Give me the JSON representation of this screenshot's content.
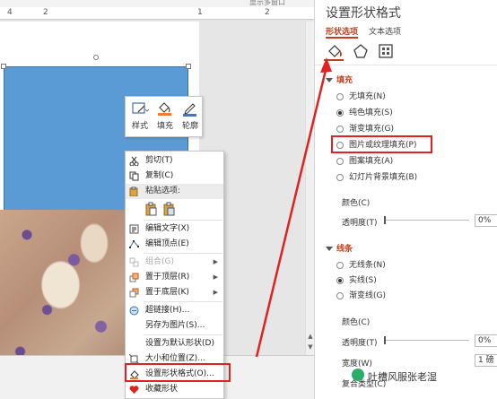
{
  "app": {
    "topstrip_text": "显示多窗口",
    "ruler": [
      "4",
      "2",
      "1",
      "2"
    ]
  },
  "mini_toolbar": {
    "style_label": "样式",
    "fill_label": "填充",
    "outline_label": "轮廓"
  },
  "context_menu": {
    "items": [
      {
        "label": "剪切(T)",
        "icon": "scissors-icon",
        "disabled": false
      },
      {
        "label": "复制(C)",
        "icon": "copy-icon",
        "disabled": false
      },
      {
        "label": "粘贴选项:",
        "icon": "paste-icon",
        "header": true
      },
      {
        "label": "编辑文字(X)",
        "icon": "edit-text-icon",
        "disabled": false
      },
      {
        "label": "编辑顶点(E)",
        "icon": "edit-points-icon",
        "disabled": false
      },
      {
        "label": "组合(G)",
        "icon": "group-icon",
        "disabled": true,
        "submenu": true
      },
      {
        "label": "置于顶层(R)",
        "icon": "bring-front-icon",
        "disabled": false,
        "submenu": true
      },
      {
        "label": "置于底层(K)",
        "icon": "send-back-icon",
        "disabled": false,
        "submenu": true
      },
      {
        "label": "超链接(H)...",
        "icon": "hyperlink-icon",
        "disabled": false
      },
      {
        "label": "另存为图片(S)...",
        "icon": "",
        "disabled": false
      },
      {
        "label": "设置为默认形状(D)",
        "icon": "",
        "disabled": false
      },
      {
        "label": "大小和位置(Z)...",
        "icon": "size-position-icon",
        "disabled": false
      },
      {
        "label": "设置形状格式(O)...",
        "icon": "format-shape-icon",
        "disabled": false,
        "highlighted": true
      },
      {
        "label": "收藏形状",
        "icon": "heart-icon",
        "disabled": false
      }
    ]
  },
  "pane": {
    "title": "设置形状格式",
    "tabs": [
      "形状选项",
      "文本选项"
    ],
    "fill_section": "填充",
    "fill_options": [
      {
        "label": "无填充(N)",
        "checked": false
      },
      {
        "label": "纯色填充(S)",
        "checked": true
      },
      {
        "label": "渐变填充(G)",
        "checked": false
      },
      {
        "label": "图片或纹理填充(P)",
        "checked": false,
        "highlighted": true
      },
      {
        "label": "图案填充(A)",
        "checked": false
      },
      {
        "label": "幻灯片背景填充(B)",
        "checked": false
      }
    ],
    "fill_color_label": "颜色(C)",
    "fill_transparency_label": "透明度(T)",
    "fill_transparency_value": "0%",
    "line_section": "线条",
    "line_options": [
      {
        "label": "无线条(N)",
        "checked": false
      },
      {
        "label": "实线(S)",
        "checked": true
      },
      {
        "label": "渐变线(G)",
        "checked": false
      }
    ],
    "line_color_label": "颜色(C)",
    "line_transparency_label": "透明度(T)",
    "line_transparency_value": "0%",
    "line_width_label": "宽度(W)",
    "line_width_value": "1 磅",
    "compound_label": "复合类型(C)"
  },
  "watermark": "吐槽风服张老湿",
  "colors": {
    "accent": "#c43e1c",
    "highlight_red": "#e0211f",
    "shape_blue": "#5b9bd5"
  }
}
